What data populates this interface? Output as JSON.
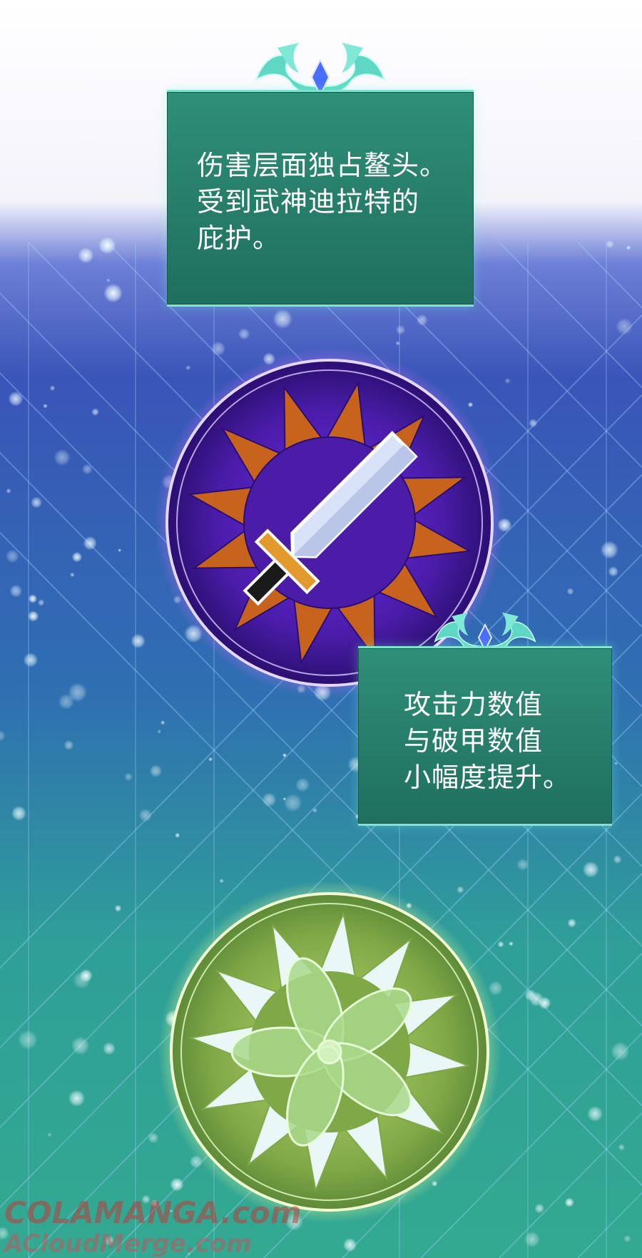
{
  "panel_top": {
    "text": "伤害层面独占鳌头。\n受到武神迪拉特的\n庇护。"
  },
  "panel_bottom": {
    "text": "攻击力数值\n与破甲数值\n小幅度提升。"
  },
  "watermark": {
    "line1": "COLAMANGA.com",
    "line2": "ACloudMerge.com"
  },
  "colors": {
    "sky_top": "#ffffff",
    "field_blue": "#3a55b8",
    "field_teal": "#2fa796",
    "panel_green": "#267a66",
    "panel_border": "#7fe3cf",
    "emblem_purple": "#4a1ca8",
    "emblem_orange": "#c8631e",
    "emblem_green": "#8ab04a"
  },
  "icons": [
    "ornament-icon",
    "crystal-icon",
    "sword-icon",
    "flower-emblem-icon"
  ]
}
